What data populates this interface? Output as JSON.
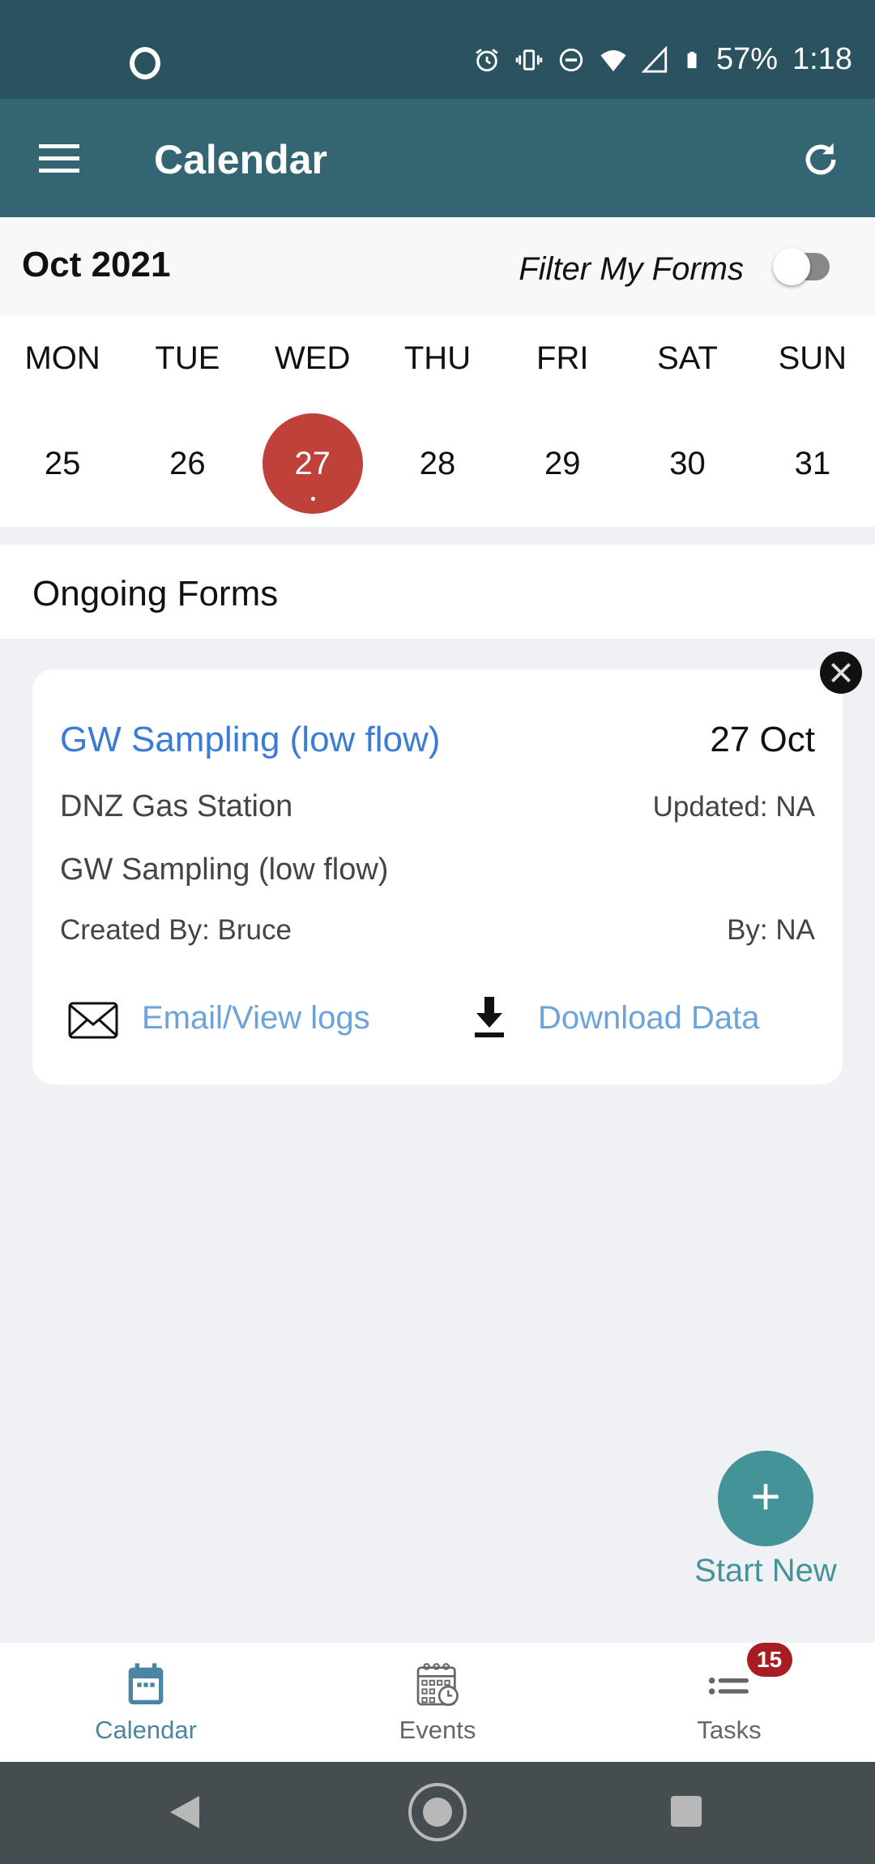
{
  "status_bar": {
    "battery": "57%",
    "time": "1:18",
    "icons": [
      "alarm-icon",
      "vibrate-icon",
      "dnd-icon",
      "wifi-icon",
      "signal-icon",
      "battery-icon"
    ]
  },
  "app_bar": {
    "title": "Calendar",
    "menu_icon": "hamburger-menu-icon",
    "refresh_icon": "refresh-icon"
  },
  "calendar": {
    "month_label": "Oct 2021",
    "filter_label": "Filter My Forms",
    "filter_on": false,
    "weekdays": [
      "MON",
      "TUE",
      "WED",
      "THU",
      "FRI",
      "SAT",
      "SUN"
    ],
    "days": [
      "25",
      "26",
      "27",
      "28",
      "29",
      "30",
      "31"
    ],
    "selected_day": "27",
    "selected_color": "#c0403a"
  },
  "ongoing": {
    "section_title": "Ongoing Forms",
    "forms": [
      {
        "title": "GW Sampling (low flow)",
        "date": "27 Oct",
        "site": "DNZ Gas Station",
        "updated": "Updated: NA",
        "form_type": "GW Sampling (low flow)",
        "created_by": "Created By: Bruce",
        "by": "By: NA",
        "email_label": "Email/View logs",
        "download_label": "Download Data"
      }
    ]
  },
  "fab": {
    "icon": "plus-icon",
    "label": "Start New",
    "color": "#449399"
  },
  "bottom_nav": {
    "items": [
      {
        "label": "Calendar",
        "icon": "calendar-icon",
        "active": true
      },
      {
        "label": "Events",
        "icon": "events-calendar-clock-icon",
        "active": false
      },
      {
        "label": "Tasks",
        "icon": "tasks-list-icon",
        "active": false,
        "badge": "15"
      }
    ]
  }
}
